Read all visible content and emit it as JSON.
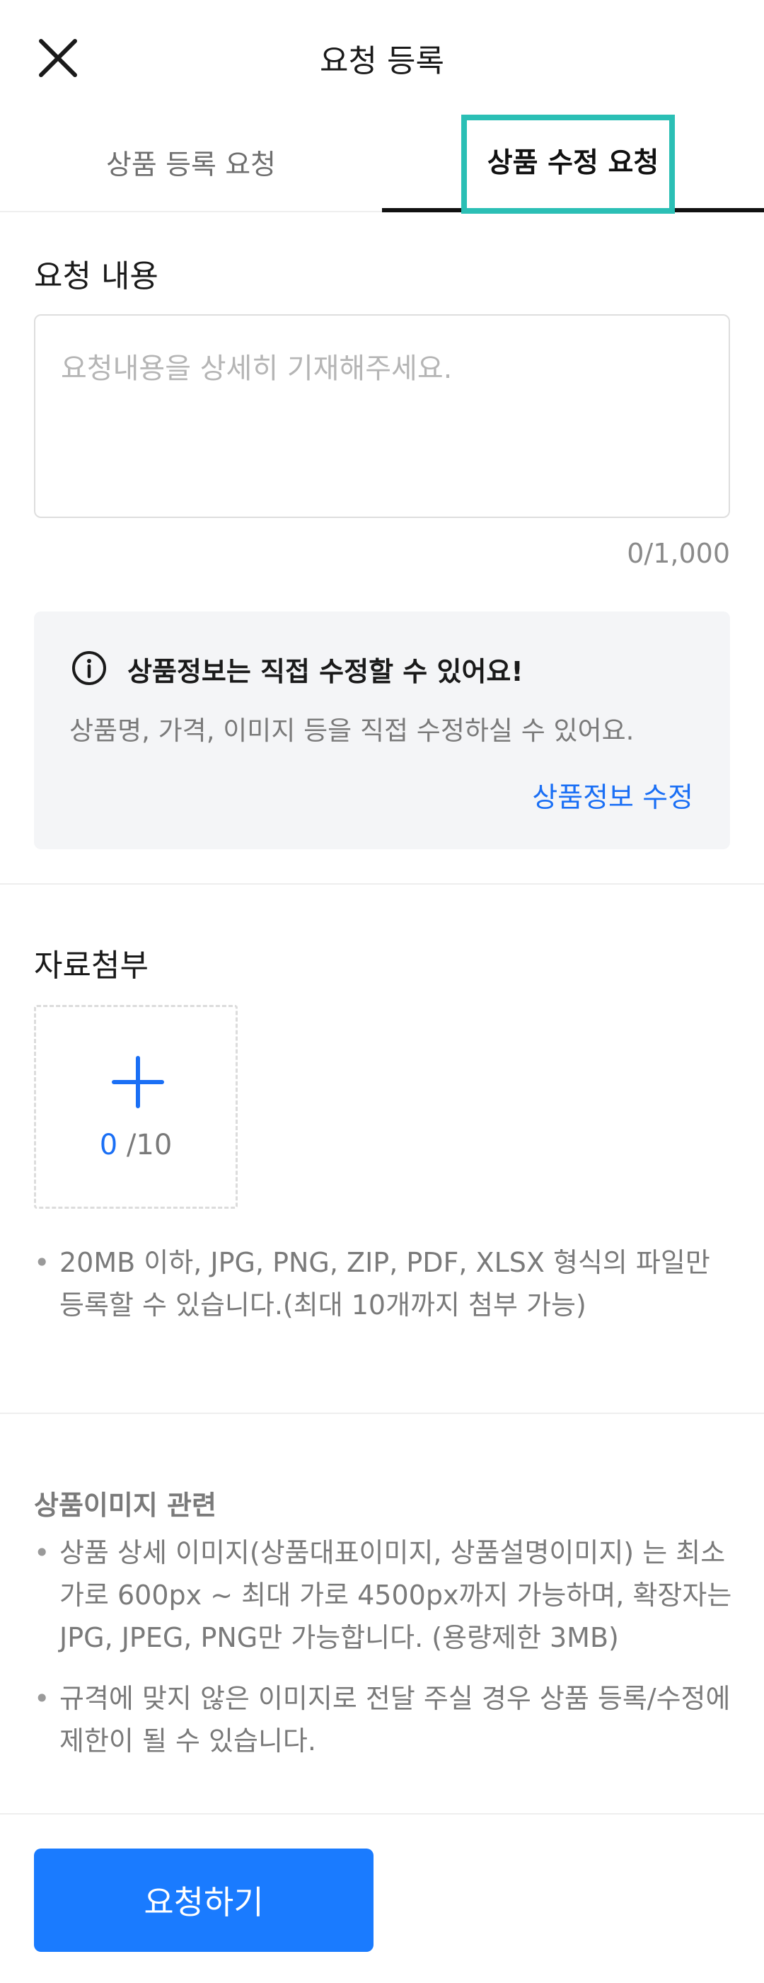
{
  "header": {
    "title": "요청 등록",
    "close_icon": "close-icon"
  },
  "tabs": [
    {
      "label": "상품 등록 요청",
      "active": false
    },
    {
      "label": "상품 수정 요청",
      "active": true
    }
  ],
  "request": {
    "title": "요청 내용",
    "placeholder": "요청내용을 상세히 기재해주세요.",
    "value": "",
    "counter": "0/1,000"
  },
  "info": {
    "icon": "info-icon",
    "title": "상품정보는 직접 수정할 수 있어요!",
    "description": "상품명, 가격, 이미지 등을 직접 수정하실 수 있어요.",
    "link_label": "상품정보 수정"
  },
  "attachment": {
    "title": "자료첨부",
    "count_current": "0",
    "count_max": "/10",
    "notes": [
      "20MB 이하, JPG, PNG, ZIP, PDF, XLSX 형식의 파일만 등록할 수 있습니다.(최대 10개까지 첨부 가능)"
    ]
  },
  "guide": {
    "title": "상품이미지 관련",
    "notes": [
      "상품 상세 이미지(상품대표이미지, 상품설명이미지) 는 최소 가로 600px ~ 최대 가로 4500px까지 가능하며, 확장자는 JPG, JPEG, PNG만 가능합니다. (용량제한 3MB)",
      "규격에 맞지 않은 이미지로 전달 주실 경우 상품 등록/수정에 제한이 될 수 있습니다."
    ]
  },
  "submit": {
    "label": "요청하기"
  },
  "colors": {
    "accent": "#1a7bff",
    "link": "#1a6ff5",
    "highlight": "#2bbfb5"
  }
}
